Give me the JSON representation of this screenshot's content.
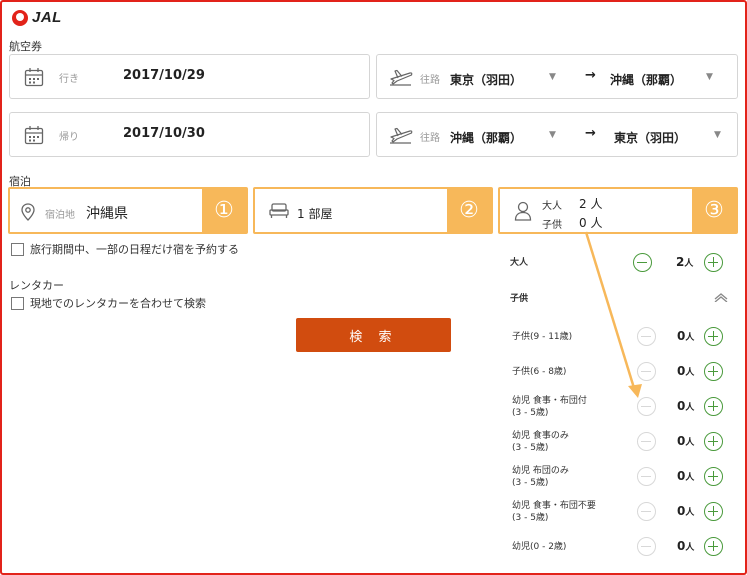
{
  "brand": {
    "logo_text": "JAL"
  },
  "sections": {
    "air": "航空券",
    "stay": "宿泊",
    "rental": "レンタカー"
  },
  "flights": [
    {
      "date_label": "行き",
      "date": "2017/10/29",
      "route_label": "往路",
      "from": "東京（羽田）",
      "arrow": "→",
      "to": "沖縄（那覇）"
    },
    {
      "date_label": "帰り",
      "date": "2017/10/30",
      "route_label": "往路",
      "from": "沖縄（那覇）",
      "arrow": "→",
      "to": "東京（羽田）"
    }
  ],
  "stay": {
    "destination_label": "宿泊地",
    "destination": "沖縄県",
    "rooms": "1 部屋",
    "adults_label": "大人",
    "adults_value": "2 人",
    "children_label": "子供",
    "children_value": "0 人",
    "badges": [
      "①",
      "②",
      "③"
    ],
    "partial_option": "旅行期間中、一部の日程だけ宿を予約する"
  },
  "rental": {
    "option": "現地でのレンタカーを合わせて検索"
  },
  "search_label": "検 索",
  "passengers": {
    "adult": {
      "label": "大人",
      "count": "2",
      "unit": "人"
    },
    "children_header": "子供",
    "rows": [
      {
        "line1": "子供(9 - 11歳)",
        "line2": "",
        "count": "0",
        "unit": "人"
      },
      {
        "line1": "子供(6 - 8歳)",
        "line2": "",
        "count": "0",
        "unit": "人"
      },
      {
        "line1": "幼児 食事・布団付",
        "line2": "(3 - 5歳)",
        "count": "0",
        "unit": "人"
      },
      {
        "line1": "幼児 食事のみ",
        "line2": "(3 - 5歳)",
        "count": "0",
        "unit": "人"
      },
      {
        "line1": "幼児 布団のみ",
        "line2": "(3 - 5歳)",
        "count": "0",
        "unit": "人"
      },
      {
        "line1": "幼児 食事・布団不要",
        "line2": "(3 - 5歳)",
        "count": "0",
        "unit": "人"
      },
      {
        "line1": "幼児(0 - 2歳)",
        "line2": "",
        "count": "0",
        "unit": "人"
      }
    ]
  },
  "colors": {
    "frame": "#e2231a",
    "highlight": "#f7b85a",
    "search": "#d14c0f",
    "stepper": "#4a9a3c"
  }
}
